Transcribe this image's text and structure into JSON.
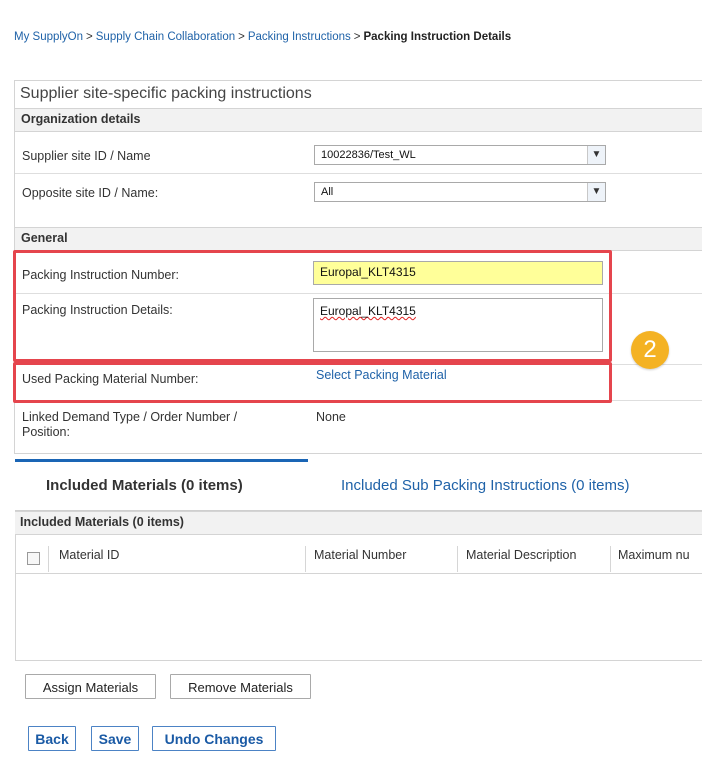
{
  "breadcrumb": {
    "items": [
      "My SupplyOn",
      "Supply Chain Collaboration",
      "Packing Instructions"
    ],
    "separator": ">",
    "current": "Packing Instruction Details"
  },
  "page_title": "Supplier site-specific packing instructions",
  "organization": {
    "heading": "Organization details",
    "supplier_site_label": "Supplier site ID / Name",
    "supplier_site_value": "10022836/Test_WL",
    "opposite_site_label": "Opposite site ID / Name:",
    "opposite_site_value": "All"
  },
  "general": {
    "heading": "General",
    "pi_number_label": "Packing Instruction Number:",
    "pi_number_value": "Europal_KLT4315",
    "pi_details_label": "Packing Instruction Details:",
    "pi_details_value": "Europal_KLT4315",
    "used_material_label": "Used Packing Material Number:",
    "used_material_link": "Select Packing Material",
    "linked_demand_label_line1": "Linked Demand Type / Order Number /",
    "linked_demand_label_line2": "Position:",
    "linked_demand_value": "None"
  },
  "annotation": {
    "badge_number": "2",
    "highlight_color": "#e5454d",
    "badge_color": "#f4b223"
  },
  "tabs": [
    {
      "label": "Included Materials (0 items)",
      "active": true
    },
    {
      "label": "Included Sub Packing Instructions (0 items)",
      "active": false
    }
  ],
  "materials_table": {
    "heading": "Included Materials (0 items)",
    "columns": [
      "Material ID",
      "Material Number",
      "Material Description",
      "Maximum nu"
    ],
    "rows": []
  },
  "table_actions": {
    "assign": "Assign Materials",
    "remove": "Remove Materials"
  },
  "footer_actions": {
    "back": "Back",
    "save": "Save",
    "undo": "Undo Changes"
  },
  "colors": {
    "link": "#1f62a8",
    "accent": "#1a65b5",
    "input_highlight": "#ffff99"
  }
}
